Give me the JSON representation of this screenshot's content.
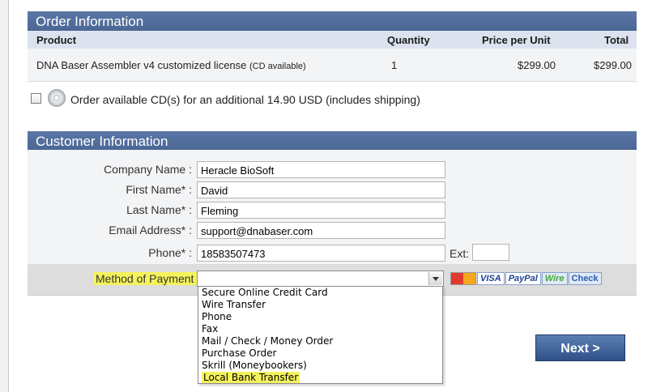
{
  "order": {
    "title": "Order Information",
    "columns": {
      "product": "Product",
      "quantity": "Quantity",
      "price": "Price per Unit",
      "total": "Total"
    },
    "row": {
      "product": "DNA Baser Assembler v4 customized license",
      "product_note": "(CD available)",
      "quantity": "1",
      "price": "$299.00",
      "total": "$299.00"
    },
    "cd_option": "Order available CD(s) for an additional 14.90 USD  (includes shipping)"
  },
  "customer": {
    "title": "Customer Information",
    "company": {
      "label": "Company Name :",
      "value": "Heracle BioSoft"
    },
    "first": {
      "label": "First Name* :",
      "value": "David"
    },
    "last": {
      "label": "Last Name* :",
      "value": "Fleming"
    },
    "email": {
      "label": "Email Address* :",
      "value": "support@dnabaser.com"
    },
    "phone": {
      "label": "Phone* :",
      "value": "18583507473"
    },
    "ext": {
      "label": "Ext:",
      "value": ""
    }
  },
  "payment": {
    "label": "Method of Payment :",
    "selected": "",
    "options": [
      "Secure Online Credit Card",
      "Wire Transfer",
      "Phone",
      "Fax",
      "Mail / Check / Money Order",
      "Purchase Order",
      "Skrill (Moneybookers)",
      "Local Bank Transfer"
    ],
    "logos": {
      "visa": "VISA",
      "paypal": "PayPal",
      "wire": "Wire",
      "check": "Check"
    }
  },
  "next_label": "Next >"
}
